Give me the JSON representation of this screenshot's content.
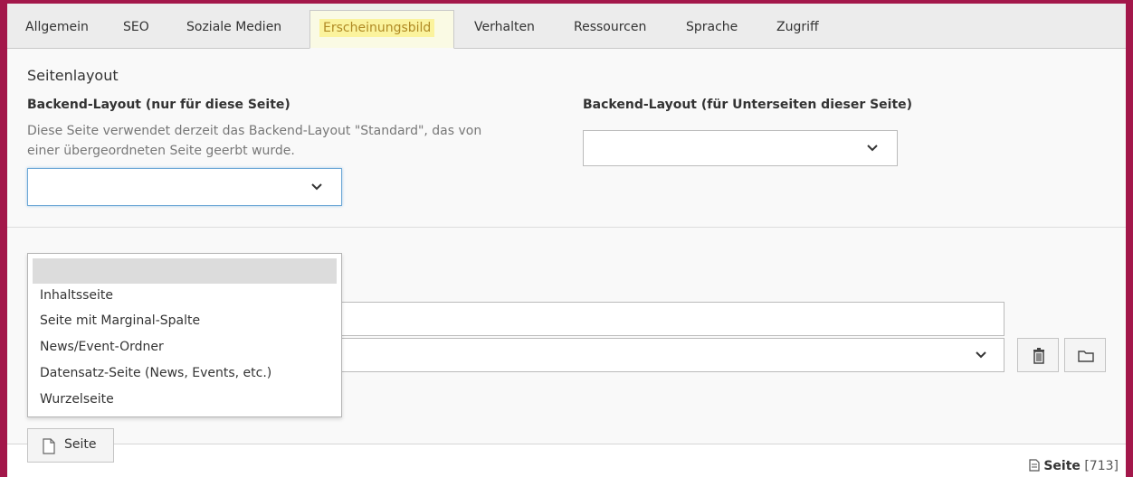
{
  "tabs": [
    {
      "label": "Allgemein"
    },
    {
      "label": "SEO"
    },
    {
      "label": "Soziale Medien"
    },
    {
      "label": "Erscheinungsbild"
    },
    {
      "label": "Verhalten"
    },
    {
      "label": "Ressourcen"
    },
    {
      "label": "Sprache"
    },
    {
      "label": "Zugriff"
    }
  ],
  "active_tab": "Erscheinungsbild",
  "section": {
    "title": "Seitenlayout",
    "backend_layout_label": "Backend-Layout (nur für diese Seite)",
    "backend_layout_desc_line1": "Diese Seite verwendet derzeit das Backend-Layout \"Standard\", das von",
    "backend_layout_desc_line2": "einer übergeordneten Seite geerbt wurde.",
    "backend_layout_sub_label": "Backend-Layout (für Unterseiten dieser Seite)",
    "backend_layout_value": "",
    "backend_layout_sub_value": ""
  },
  "dropdown": {
    "options": [
      "",
      "Inhaltsseite",
      "Seite mit Marginal-Spalte",
      "News/Event-Ordner",
      "Datensatz-Seite (News, Events, etc.)",
      "Wurzelseite"
    ]
  },
  "page_button": {
    "label": "Seite"
  },
  "footer": {
    "type": "Seite",
    "uid": "[713]"
  },
  "icons": {
    "chevron": "chevron-down-icon",
    "trash": "trash-icon",
    "folder": "folder-icon",
    "page": "page-icon"
  },
  "colors": {
    "frame": "#a3174a",
    "active_tab_highlight": "#fbf39d",
    "focus_border": "#6da8d6"
  }
}
